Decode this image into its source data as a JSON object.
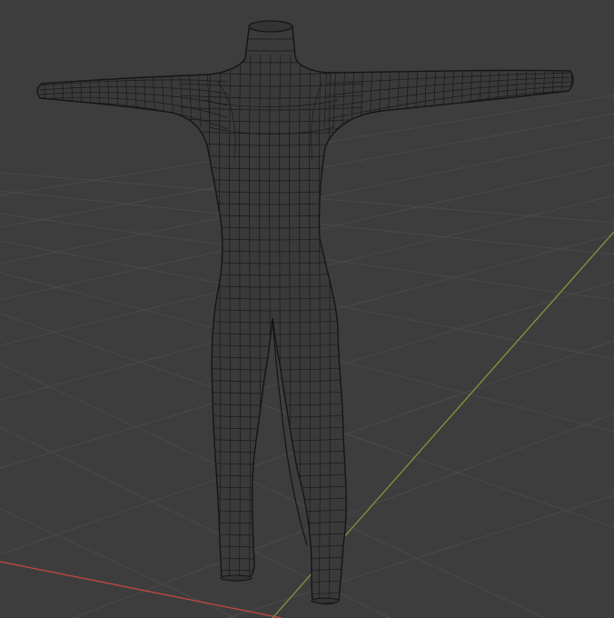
{
  "viewport": {
    "background_color": "#3d3d3d",
    "grid_color": "#4a4a4a",
    "mesh_fill_color": "#3a3a3a",
    "wire_color": "#1a1a1a",
    "x_axis_color": "#c84646",
    "y_axis_color": "#7c9a3a"
  },
  "object": {
    "kind": "humanoid-mesh",
    "mode": "wireframe-overlay"
  }
}
